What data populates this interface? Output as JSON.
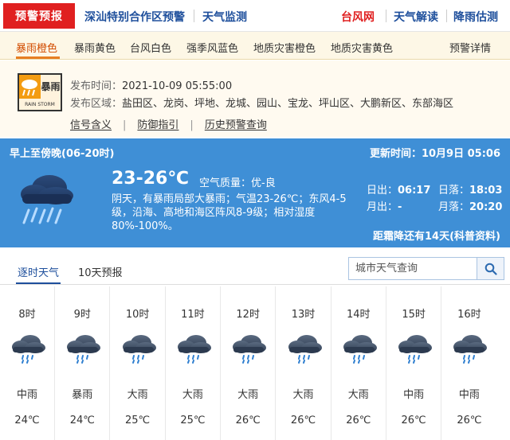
{
  "topnav": {
    "badge": "预警预报",
    "items": [
      "深汕特别合作区预警",
      "天气监测"
    ],
    "right_items": [
      "台风网",
      "天气解读",
      "降雨估测"
    ]
  },
  "subtabs": {
    "items": [
      "暴雨橙色",
      "暴雨黄色",
      "台风白色",
      "强季风蓝色",
      "地质灾害橙色",
      "地质灾害黄色"
    ],
    "details": "预警详情"
  },
  "warning": {
    "icon_text": "暴雨",
    "icon_sub": "RAIN STORM",
    "time_label": "发布时间：",
    "time_value": "2021-10-09 05:55:00",
    "area_label": "发布区域：",
    "area_value": "盐田区、龙岗、坪地、龙城、园山、宝龙、坪山区、大鹏新区、东部海区",
    "links": [
      "信号含义",
      "防御指引",
      "历史预警查询"
    ]
  },
  "weather": {
    "period": "早上至傍晚(06-20时)",
    "update": "更新时间：10月9日 05:06",
    "temp": "23-26℃",
    "aqi": "空气质量：优-良",
    "desc": "阴天，有暴雨局部大暴雨；气温23-26℃；东风4-5级，沿海、高地和海区阵风8-9级；相对湿度80%-100%。",
    "sunrise_label": "日出：",
    "sunrise": "06:17",
    "sunset_label": "日落：",
    "sunset": "18:03",
    "moonrise_label": "月出：",
    "moonrise": "-",
    "moonset_label": "月落：",
    "moonset": "20:20",
    "frost": "距霜降还有14天(科普资料)"
  },
  "htabs": {
    "items": [
      "逐时天气",
      "10天预报"
    ],
    "search_placeholder": "城市天气查询"
  },
  "hourly": [
    {
      "time": "8时",
      "cond": "中雨",
      "temp": "24℃"
    },
    {
      "time": "9时",
      "cond": "暴雨",
      "temp": "24℃"
    },
    {
      "time": "10时",
      "cond": "大雨",
      "temp": "25℃"
    },
    {
      "time": "11时",
      "cond": "大雨",
      "temp": "25℃"
    },
    {
      "time": "12时",
      "cond": "大雨",
      "temp": "26℃"
    },
    {
      "time": "13时",
      "cond": "大雨",
      "temp": "26℃"
    },
    {
      "time": "14时",
      "cond": "大雨",
      "temp": "26℃"
    },
    {
      "time": "15时",
      "cond": "中雨",
      "temp": "26℃"
    },
    {
      "time": "16时",
      "cond": "中雨",
      "temp": "26℃"
    }
  ],
  "colors": {
    "badge_red": "#e02020",
    "nav_blue": "#1e4f9c",
    "panel_blue": "#3f8fd6",
    "warning_orange": "#f39c12"
  }
}
